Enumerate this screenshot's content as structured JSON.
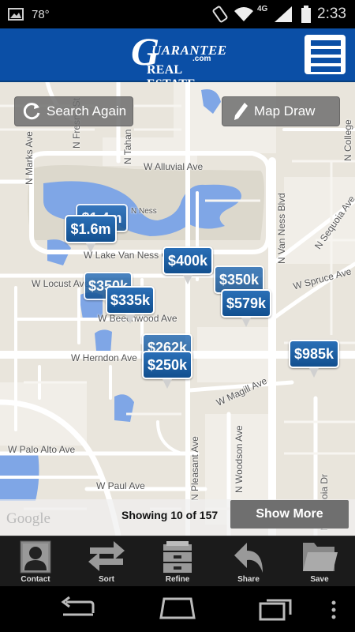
{
  "status_bar": {
    "temperature": "78°",
    "network": "4G",
    "time": "2:33"
  },
  "header": {
    "logo_line1": "UARANTEE",
    "logo_letter": "G",
    "logo_com": ".com",
    "logo_line2": "REAL ESTATE"
  },
  "map": {
    "search_again": "Search Again",
    "map_draw": "Map Draw",
    "roads": {
      "n_marks_ave": "N Marks Ave",
      "n_fresno": "N Fresno St",
      "n_tahan": "N Tahan",
      "w_alluvial": "W Alluvial Ave",
      "w_lake_van_ness_cir": "W Lake Van Ness Cir",
      "n_ness": "N Ness",
      "w_locust": "W Locust Ave",
      "w_beechwood": "W Beechwood Ave",
      "w_herndon": "W Herndon Ave",
      "w_magill": "W Magill Ave",
      "w_palo_alto": "W Palo Alto Ave",
      "w_paul": "W Paul Ave",
      "n_van_ness_blvd": "N Van Ness Blvd",
      "n_sequoia": "N Sequoia Ave",
      "w_spruce": "W Spruce Ave",
      "n_pleasant": "N Pleasant Ave",
      "n_woodson": "N Woodson Ave",
      "n_sequoia_dr": "N Sequoia Dr",
      "n_college": "N College"
    },
    "pins": [
      {
        "label": "$1.4m"
      },
      {
        "label": "$1.6m"
      },
      {
        "label": "$400k"
      },
      {
        "label": "$350k"
      },
      {
        "label": "$579k"
      },
      {
        "label": "$350k"
      },
      {
        "label": "$335k"
      },
      {
        "label": "$262k"
      },
      {
        "label": "$250k"
      },
      {
        "label": "$985k"
      }
    ],
    "google": "Google",
    "showing_text": "Showing 10 of 157",
    "show_more": "Show More"
  },
  "toolbar": {
    "items": [
      {
        "label": "Contact",
        "icon": "contact-icon"
      },
      {
        "label": "Sort",
        "icon": "sort-icon"
      },
      {
        "label": "Refine",
        "icon": "refine-icon"
      },
      {
        "label": "Share",
        "icon": "share-icon"
      },
      {
        "label": "Save",
        "icon": "save-icon"
      }
    ]
  }
}
